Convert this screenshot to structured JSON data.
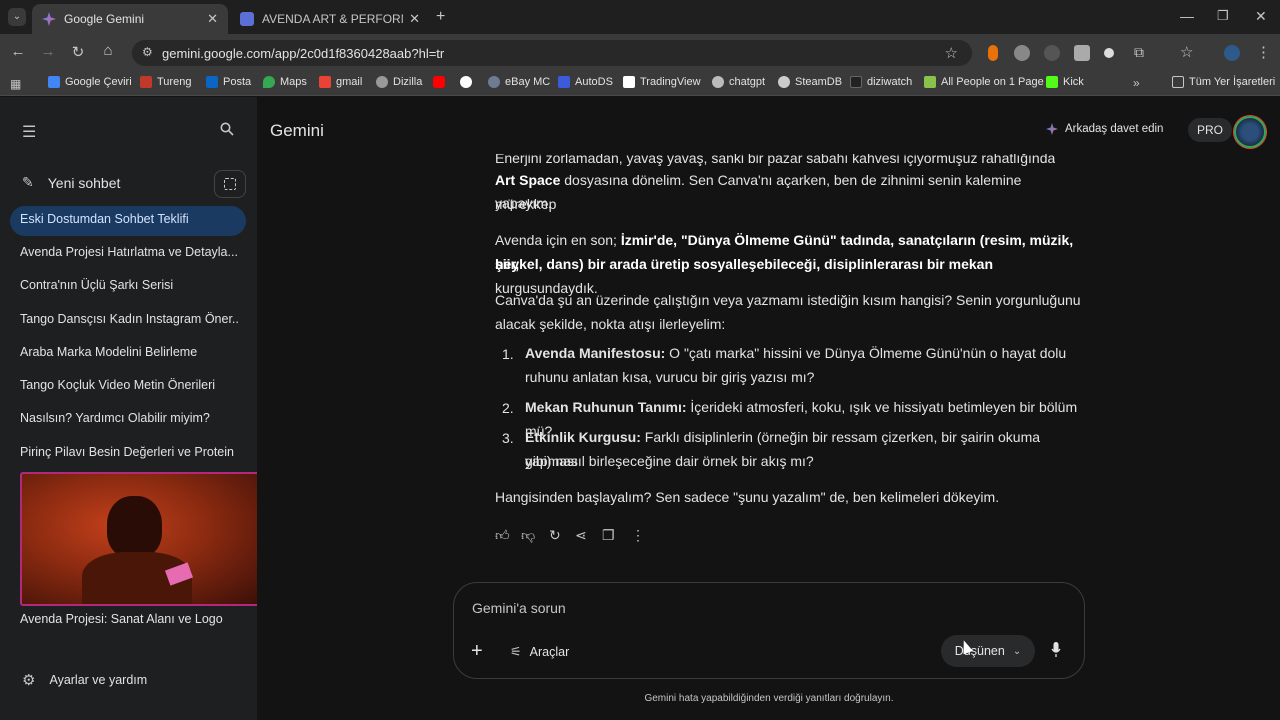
{
  "tabs": [
    {
      "title": "Google Gemini",
      "active": true
    },
    {
      "title": "AVENDA ART & PERFORMANCE",
      "active": false
    }
  ],
  "address": "gemini.google.com/app/2c0d1f8360428aab?hl=tr",
  "bookmarks": [
    "Google Çeviri",
    "Tureng",
    "Posta",
    "Maps",
    "gmail",
    "Dizilla",
    "eBay MC",
    "AutoDS",
    "TradingView",
    "chatgpt",
    "SteamDB",
    "diziwatch",
    "All People on 1 Page",
    "Kick"
  ],
  "bookmarks_all": "Tüm Yer İşaretleri",
  "header": {
    "app_title": "Gemini",
    "invite": "Arkadaş davet edin",
    "pro": "PRO"
  },
  "sidebar": {
    "new_chat": "Yeni sohbet",
    "items": [
      "Eski Dostumdan Sohbet Teklifi",
      "Avenda Projesi Hatırlatma ve Detayla...",
      "Contra'nın Üçlü Şarkı Serisi",
      "Tango Dansçısı Kadın Instagram Öner...",
      "Araba Marka Modelini Belirleme",
      "Tango Koçluk Video Metin Önerileri",
      "Nasılsın? Yardımcı Olabilir miyim?",
      "Pirinç Pilavı Besin Değerleri ve Protein",
      "Avenda Projesi: Sanat Alanı ve Logo"
    ],
    "settings": "Ayarlar ve yardım"
  },
  "chat": {
    "p0_cut": "Enerjini zorlamadan, yavaş yavaş, sanki bir pazar sabahı kahvesi içiyormuşuz rahatlığında Avenda",
    "p0a_bold": "Art Space",
    "p0a_rest": " dosyasına dönelim. Sen Canva'nı açarken, ben de zihnimi senin kalemine mürekkep",
    "p0b": "yapayım.",
    "p1_pre": "Avenda için en son; ",
    "p1_bold1": "İzmir'de, \"Dünya Ölmeme Günü\" tadında, sanatçıların (resim, müzik, şiir,",
    "p1_bold2": "heykel, dans) bir arada üretip sosyalleşebileceği, disiplinlerarası bir mekan",
    "p1_post": " kurgusundaydık.",
    "p2a": "Canva'da şu an üzerinde çalıştığın veya yazmamı istediğin kısım hangisi? Senin yorgunluğunu",
    "p2b": "alacak şekilde, nokta atışı ilerleyelim:",
    "list": [
      {
        "num": "1.",
        "bold": "Avenda Manifestosu:",
        "text1": " O \"çatı marka\" hissini ve Dünya Ölmeme Günü'nün o hayat dolu",
        "text2": "ruhunu anlatan kısa, vurucu bir giriş yazısı mı?"
      },
      {
        "num": "2.",
        "bold": "Mekan Ruhunun Tanımı:",
        "text1": " İçerideki atmosferi, koku, ışık ve hissiyatı betimleyen bir bölüm mü?",
        "text2": ""
      },
      {
        "num": "3.",
        "bold": "Etkinlik Kurgusu:",
        "text1": " Farklı disiplinlerin (örneğin bir ressam çizerken, bir şairin okuma yapması",
        "text2": "gibi) nasıl birleşeceğine dair örnek bir akış mı?"
      }
    ],
    "p3": "Hangisinden başlayalım? Sen sadece \"şunu yazalım\" de, ben kelimeleri dökeyim."
  },
  "input": {
    "placeholder": "Gemini'a sorun",
    "tools": "Araçlar",
    "mode": "Düşünen"
  },
  "disclaimer": "Gemini hata yapabildiğinden verdiği yanıtları doğrulayın.",
  "colors": {
    "accent": "#1b3a62",
    "bg": "#131314",
    "sidebar": "#1e1f20"
  }
}
